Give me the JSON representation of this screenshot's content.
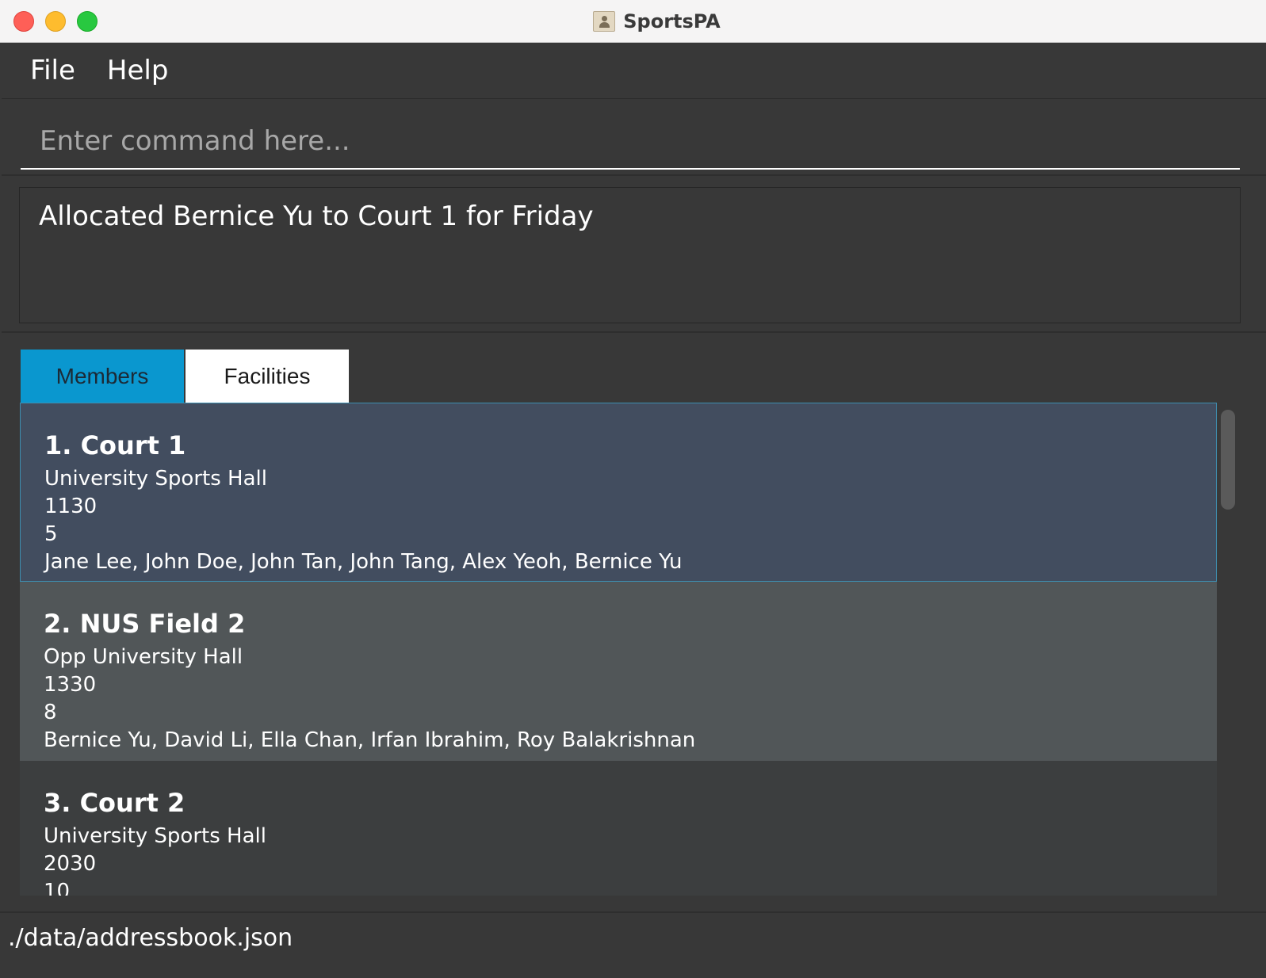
{
  "window": {
    "title": "SportsPA"
  },
  "menu": {
    "file": "File",
    "help": "Help"
  },
  "command": {
    "placeholder": "Enter command here..."
  },
  "result": {
    "message": "Allocated Bernice Yu to Court 1 for Friday"
  },
  "tabs": {
    "members": "Members",
    "facilities": "Facilities",
    "active": "Facilities"
  },
  "facilities": [
    {
      "index_name": "1. Court 1",
      "location": "University Sports Hall",
      "time": "1130",
      "capacity": "5",
      "members": "Jane Lee, John Doe, John Tan, John Tang, Alex Yeoh, Bernice Yu"
    },
    {
      "index_name": "2. NUS Field 2",
      "location": "Opp University Hall",
      "time": "1330",
      "capacity": "8",
      "members": "Bernice Yu, David Li, Ella Chan, Irfan Ibrahim, Roy Balakrishnan"
    },
    {
      "index_name": "3. Court 2",
      "location": "University Sports Hall",
      "time": "2030",
      "capacity": "10",
      "members": ""
    }
  ],
  "status": {
    "path": "./data/addressbook.json"
  },
  "colors": {
    "tab_members": "#0a97cf",
    "selected_card": "#424d5f",
    "alt_card": "#515658"
  }
}
